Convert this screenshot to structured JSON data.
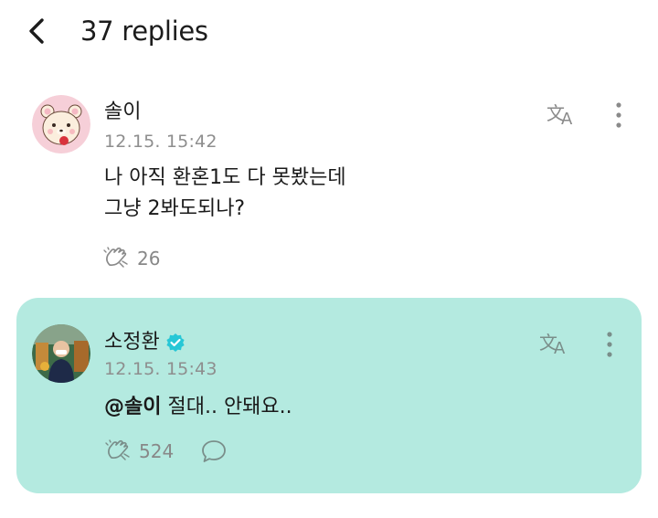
{
  "header": {
    "title": "37 replies",
    "back_icon": "chevron-left-icon"
  },
  "comments": [
    {
      "author": "솔이",
      "timestamp": "12.15. 15:42",
      "lines": [
        "나 아직 환혼1도 다 못봤는데",
        "그냥 2봐도되나?"
      ],
      "likes": "26",
      "avatar": "bear-avatar"
    },
    {
      "author": "소정환",
      "verified": true,
      "timestamp": "12.15. 15:43",
      "mention": "@솔이",
      "text": "절대.. 안돼요..",
      "likes": "524",
      "highlighted_color": "#b4eae0",
      "verified_color": "#27c7d6",
      "avatar": "photo-avatar"
    }
  ]
}
